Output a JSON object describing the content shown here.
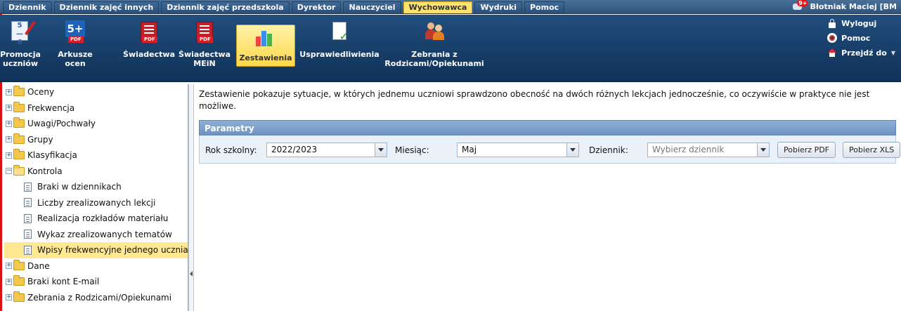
{
  "topmenu": {
    "items": [
      "Dziennik",
      "Dziennik zajęć innych",
      "Dziennik zajęć przedszkola",
      "Dyrektor",
      "Nauczyciel",
      "Wychowawca",
      "Wydruki",
      "Pomoc"
    ],
    "active": "Wychowawca"
  },
  "user": {
    "badge": "9+",
    "name": "Błotniak Maciej [BM"
  },
  "toolbar": {
    "buttons": [
      {
        "label": "Promocja\nuczniów",
        "icon": "promotion-icon"
      },
      {
        "label": "Arkusze\nocen",
        "icon": "pdf-grade-5-icon",
        "tag": "PDF"
      },
      {
        "label": "Świadectwa",
        "icon": "certificate-pdf-icon",
        "tag": "PDF"
      },
      {
        "label": "Świadectwa\nMEiN",
        "icon": "certificate-mein-pdf-icon",
        "tag": "PDF"
      },
      {
        "label": "Zestawienia",
        "icon": "chart-icon",
        "active": true
      },
      {
        "label": "Usprawiedliwienia",
        "icon": "excuse-doc-icon"
      },
      {
        "label": "Zebrania z\nRodzicami/Opiekunami",
        "icon": "parents-meeting-icon"
      }
    ],
    "right_links": [
      "Wyloguj",
      "Pomoc",
      "Przejdź do"
    ]
  },
  "tree": [
    {
      "label": "Oceny",
      "type": "folder",
      "expanded": false
    },
    {
      "label": "Frekwencja",
      "type": "folder",
      "expanded": false
    },
    {
      "label": "Uwagi/Pochwały",
      "type": "folder",
      "expanded": false
    },
    {
      "label": "Grupy",
      "type": "folder",
      "expanded": false
    },
    {
      "label": "Klasyfikacja",
      "type": "folder",
      "expanded": false
    },
    {
      "label": "Kontrola",
      "type": "folder",
      "expanded": true
    },
    {
      "label": "Braki w dziennikach",
      "type": "leaf"
    },
    {
      "label": "Liczby zrealizowanych lekcji",
      "type": "leaf"
    },
    {
      "label": "Realizacja rozkładów materiału",
      "type": "leaf"
    },
    {
      "label": "Wykaz zrealizowanych tematów",
      "type": "leaf"
    },
    {
      "label": "Wpisy frekwencyjne jednego ucznia",
      "type": "leaf",
      "selected": true
    },
    {
      "label": "Dane",
      "type": "folder",
      "expanded": false
    },
    {
      "label": "Braki kont E-mail",
      "type": "folder",
      "expanded": false
    },
    {
      "label": "Zebrania z Rodzicami/Opiekunami",
      "type": "folder",
      "expanded": false
    }
  ],
  "main": {
    "description": "Zestawienie pokazuje sytuacje, w których jednemu uczniowi sprawdzono obecność na dwóch różnych lekcjach jednocześnie, co oczywiście w praktyce nie jest możliwe.",
    "params_title": "Parametry",
    "rok_label": "Rok szkolny:",
    "rok_value": "2022/2023",
    "miesiac_label": "Miesiąc:",
    "miesiac_value": "Maj",
    "dziennik_label": "Dziennik:",
    "dziennik_placeholder": "Wybierz dziennik",
    "btn_pdf": "Pobierz PDF",
    "btn_xls": "Pobierz XLS"
  }
}
